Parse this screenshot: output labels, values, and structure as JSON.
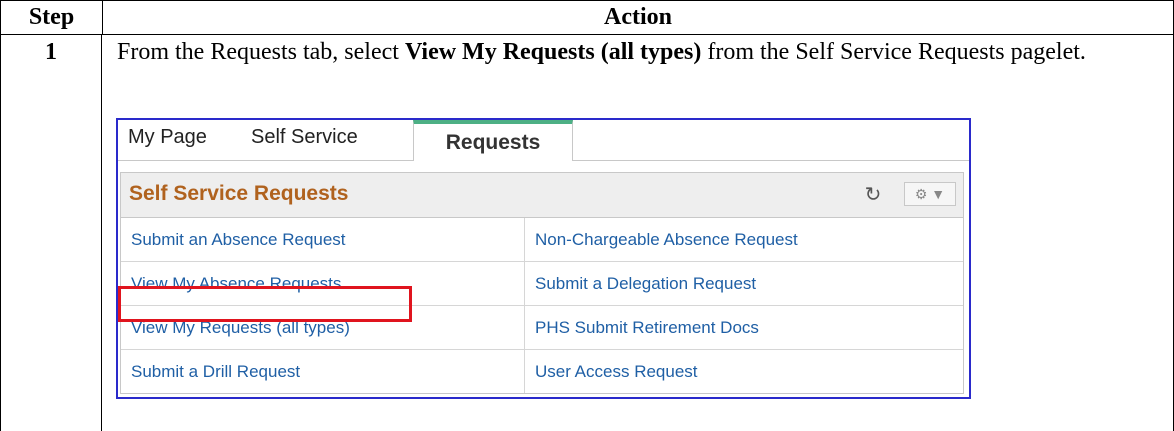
{
  "table": {
    "header_step": "Step",
    "header_action": "Action",
    "row_step": "1",
    "instruction_pre": "From the Requests tab, select ",
    "instruction_bold": "View My Requests (all types)",
    "instruction_post": " from the Self Service Requests pagelet."
  },
  "screenshot": {
    "tabs": [
      {
        "label": "My Page",
        "active": false
      },
      {
        "label": "Self Service",
        "active": false
      },
      {
        "label": "Requests",
        "active": true
      }
    ],
    "pagelet": {
      "title": "Self Service Requests",
      "refresh_icon": "refresh-icon",
      "menu_icon": "gear-dropdown-icon",
      "links_left": [
        "Submit an Absence Request",
        "View My Absence Requests",
        "View My Requests (all types)",
        "Submit a Drill Request"
      ],
      "links_right": [
        "Non-Chargeable Absence Request",
        "Submit a Delegation Request",
        "PHS Submit Retirement Docs",
        "User Access Request"
      ],
      "highlighted_link": "View My Requests (all types)"
    },
    "colors": {
      "border": "#2a2acb",
      "active_tab_accent": "#4db085",
      "pagelet_title": "#b0621e",
      "link": "#1f5fa5",
      "highlight": "#e0141e"
    }
  }
}
